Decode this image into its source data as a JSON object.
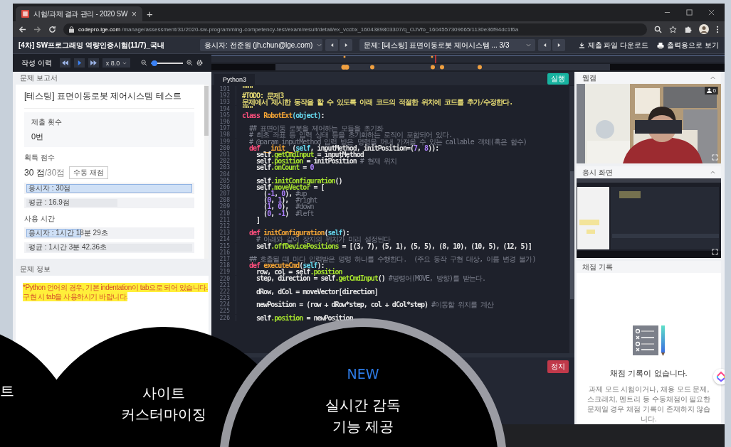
{
  "browser": {
    "tab_title": "시험/과제 결과 관리 - 2020 SW",
    "tab_close": "×",
    "new_tab": "+",
    "url_host": "codepro.lge.com",
    "url_path": "/manage/assessment/31/2020-sw-programming-competency-test/exam/result/detail/ex_vccbx_1604389803307/q_OJVfo_1604557309665/1130e36f94dc1f6a"
  },
  "app_header": {
    "title": "[4차] SW프로그래밍 역량인증시험(11/7)_국내",
    "candidate": "응시자: 전준원 (jh.chun@lge.com)",
    "problem": "문제: [테스팅] 표면이동로봇 제어시스템 ... 3/3",
    "actions": [
      {
        "kind": "download",
        "label": "제출 파일 다운로드"
      },
      {
        "kind": "print",
        "label": "출력용으로 보기"
      }
    ]
  },
  "history_bar": {
    "label": "작성 이력",
    "speed": "x 8.0",
    "zoom": {
      "level": 0.1
    }
  },
  "report": {
    "header": "문제 보고서",
    "title": "[테스팅] 표면이동로봇 제어시스템 테스트",
    "submissions": {
      "label": "제출 횟수",
      "value": "0번"
    },
    "score": {
      "label": "획득 점수",
      "value": "30 점",
      "max": "/30점",
      "button": "수동 채점",
      "bars": [
        {
          "kind": "candidate",
          "text": "응시자 : 30점",
          "level": 1
        },
        {
          "kind": "average",
          "text": "평균 : 16.9점",
          "level": 0.55
        }
      ]
    },
    "time": {
      "label": "사용 시간",
      "bars": [
        {
          "kind": "candidate",
          "text": "응시자 : 1시간 18분 29초",
          "level": 0.33
        },
        {
          "kind": "average",
          "text": "평균 : 1시간 3분 42.36초",
          "level": 1
        }
      ]
    }
  },
  "problem_info": {
    "header": "문제 정보",
    "notice": [
      "*Python 언어의 경우, 기본 indentation이 tab으로 되어 있습니다.",
      "구현 시 tab을 사용하시기 바랍니다."
    ]
  },
  "editor": {
    "tab": "Python3",
    "run_button": "실행",
    "stop_button": "정지",
    "lines": [
      {
        "number": "191",
        "tokens": [
          {
            "kind": "str",
            "text": "\"\"\""
          }
        ]
      },
      {
        "number": "192",
        "tokens": [
          {
            "kind": "str",
            "text": "#TODO: 문제3"
          }
        ]
      },
      {
        "number": "193",
        "tokens": [
          {
            "kind": "str",
            "text": "문제에서 제시한 동작을 할 수 있도록 아래 코드의 적절한 위치에 코드를 추가/수정한다."
          }
        ]
      },
      {
        "number": "194",
        "tokens": [
          {
            "kind": "str",
            "text": "\"\"\""
          }
        ]
      },
      {
        "number": "195",
        "tokens": [
          {
            "kind": "kw",
            "text": "class "
          },
          {
            "kind": "name",
            "text": "RobotExt"
          },
          {
            "kind": "type",
            "text": "(object)"
          },
          {
            "kind": "plain",
            "text": ":"
          }
        ]
      },
      {
        "number": "196"
      },
      {
        "number": "197",
        "tokens": [
          {
            "kind": "cmt",
            "text": "  ## 표면이동 로봇을 제어하는 모듈을 초기화"
          }
        ]
      },
      {
        "number": "198",
        "tokens": [
          {
            "kind": "cmt",
            "text": "  # 최초 좌표 등 입력 상태 등을 초기화하는 로직이 포함되어 있다."
          }
        ]
      },
      {
        "number": "199",
        "tokens": [
          {
            "kind": "cmt",
            "text": "  # @param inputMethod 입력 받은 명령을 꺼내 가져올 수 있는 callable 객체(혹은 함수)"
          }
        ]
      },
      {
        "number": "200",
        "tokens": [
          {
            "kind": "kw",
            "text": "  def "
          },
          {
            "kind": "name",
            "text": "__init__"
          },
          {
            "kind": "plain",
            "text": "("
          },
          {
            "kind": "type",
            "text": "self"
          },
          {
            "kind": "plain",
            "text": ", inputMethod, initPosition=("
          },
          {
            "kind": "num",
            "text": "7"
          },
          {
            "kind": "plain",
            "text": ", "
          },
          {
            "kind": "num",
            "text": "8"
          },
          {
            "kind": "plain",
            "text": ")):"
          }
        ]
      },
      {
        "number": "201",
        "tokens": [
          {
            "kind": "plain",
            "text": "    self"
          },
          {
            "kind": "attr",
            "text": ".getCmdInput"
          },
          {
            "kind": "plain",
            "text": " = inputMethod"
          }
        ]
      },
      {
        "number": "202",
        "tokens": [
          {
            "kind": "plain",
            "text": "    self"
          },
          {
            "kind": "attr",
            "text": ".position"
          },
          {
            "kind": "plain",
            "text": " = initPosition "
          },
          {
            "kind": "cmt",
            "text": "# 현재 위치"
          }
        ]
      },
      {
        "number": "203",
        "tokens": [
          {
            "kind": "plain",
            "text": "    self"
          },
          {
            "kind": "attr",
            "text": ".onCount"
          },
          {
            "kind": "plain",
            "text": " = "
          },
          {
            "kind": "num",
            "text": "0"
          }
        ]
      },
      {
        "number": "204"
      },
      {
        "number": "205",
        "tokens": [
          {
            "kind": "plain",
            "text": "    self"
          },
          {
            "kind": "attr",
            "text": ".initConfiguration"
          },
          {
            "kind": "plain",
            "text": "()"
          }
        ]
      },
      {
        "number": "206",
        "tokens": [
          {
            "kind": "plain",
            "text": "    self"
          },
          {
            "kind": "attr",
            "text": ".moveVector"
          },
          {
            "kind": "plain",
            "text": " = ["
          }
        ]
      },
      {
        "number": "207",
        "tokens": [
          {
            "kind": "plain",
            "text": "      ("
          },
          {
            "kind": "num",
            "text": "-1"
          },
          {
            "kind": "plain",
            "text": ", "
          },
          {
            "kind": "num",
            "text": "0"
          },
          {
            "kind": "plain",
            "text": "), "
          },
          {
            "kind": "cmt",
            "text": "#up"
          }
        ]
      },
      {
        "number": "208",
        "tokens": [
          {
            "kind": "plain",
            "text": "      ("
          },
          {
            "kind": "num",
            "text": "0"
          },
          {
            "kind": "plain",
            "text": ", "
          },
          {
            "kind": "num",
            "text": "1"
          },
          {
            "kind": "plain",
            "text": "),  "
          },
          {
            "kind": "cmt",
            "text": "#right"
          }
        ]
      },
      {
        "number": "209",
        "tokens": [
          {
            "kind": "plain",
            "text": "      ("
          },
          {
            "kind": "num",
            "text": "1"
          },
          {
            "kind": "plain",
            "text": ", "
          },
          {
            "kind": "num",
            "text": "0"
          },
          {
            "kind": "plain",
            "text": "),  "
          },
          {
            "kind": "cmt",
            "text": "#down"
          }
        ]
      },
      {
        "number": "210",
        "tokens": [
          {
            "kind": "plain",
            "text": "      ("
          },
          {
            "kind": "num",
            "text": "0"
          },
          {
            "kind": "plain",
            "text": ", "
          },
          {
            "kind": "num",
            "text": "-1"
          },
          {
            "kind": "plain",
            "text": ")  "
          },
          {
            "kind": "cmt",
            "text": "#left"
          }
        ]
      },
      {
        "number": "211",
        "tokens": [
          {
            "kind": "plain",
            "text": "    ]"
          }
        ]
      },
      {
        "number": "212"
      },
      {
        "number": "213",
        "tokens": [
          {
            "kind": "kw",
            "text": "  def "
          },
          {
            "kind": "name",
            "text": "initConfiguration"
          },
          {
            "kind": "plain",
            "text": "("
          },
          {
            "kind": "type",
            "text": "self"
          },
          {
            "kind": "plain",
            "text": "):"
          }
        ]
      },
      {
        "number": "214",
        "tokens": [
          {
            "kind": "cmt",
            "text": "    # 아래와 같이 장치의 위치가 미리 설정된다"
          }
        ]
      },
      {
        "number": "215",
        "tokens": [
          {
            "kind": "plain",
            "text": "    self"
          },
          {
            "kind": "attr",
            "text": ".offDevicePositions"
          },
          {
            "kind": "plain",
            "text": " = [(3, 7), (5, 1), (5, 5), (8, 10), (10, 5), (12, 5)]"
          }
        ]
      },
      {
        "number": "216"
      },
      {
        "number": "217",
        "tokens": [
          {
            "kind": "cmt",
            "text": "  ## 호출될 때 마다 입력받은 명령 하나를 수행한다.  (주요 동작 구현 대상, 이름 변경 불가)"
          }
        ]
      },
      {
        "number": "218",
        "tokens": [
          {
            "kind": "kw",
            "text": "  def "
          },
          {
            "kind": "name",
            "text": "executeCmd"
          },
          {
            "kind": "plain",
            "text": "("
          },
          {
            "kind": "type",
            "text": "self"
          },
          {
            "kind": "plain",
            "text": "):"
          }
        ]
      },
      {
        "number": "219",
        "tokens": [
          {
            "kind": "plain",
            "text": "    row, col = self"
          },
          {
            "kind": "attr",
            "text": ".position"
          }
        ]
      },
      {
        "number": "220",
        "tokens": [
          {
            "kind": "plain",
            "text": "    step, direction = self"
          },
          {
            "kind": "attr",
            "text": ".getCmdInput"
          },
          {
            "kind": "plain",
            "text": "() "
          },
          {
            "kind": "cmt",
            "text": "#명령어(MOVE, 방향)를 받는다."
          }
        ]
      },
      {
        "number": "221"
      },
      {
        "number": "222",
        "tokens": [
          {
            "kind": "plain",
            "text": "    dRow, dCol = moveVector[direction]"
          }
        ]
      },
      {
        "number": "223"
      },
      {
        "number": "224",
        "tokens": [
          {
            "kind": "plain",
            "text": "    newPosition = (row + dRow*step, col + dCol*step) "
          },
          {
            "kind": "cmt",
            "text": "#이동할 위치를 계산"
          }
        ]
      },
      {
        "number": "225"
      },
      {
        "number": "226",
        "tokens": [
          {
            "kind": "plain",
            "text": "    self"
          },
          {
            "kind": "attr",
            "text": ".position"
          },
          {
            "kind": "plain",
            "text": " = newPosition"
          }
        ]
      }
    ]
  },
  "side": {
    "webcam": {
      "header": "웹캠",
      "viewers": "0"
    },
    "screen": {
      "header": "응시 화면"
    },
    "grading": {
      "header": "채점 기록",
      "empty_title": "채점 기록이 없습니다.",
      "empty_text": "과제 모드 시험이거나, 채용 모드 문제, 스크래치, 멘트리 등 수동채점이 필요한 문제일 경우 채점 기록이 존재하지 않습니다."
    }
  },
  "promo": [
    {
      "lines": [
        "트"
      ]
    },
    {
      "lines": [
        "사이트",
        "커스터마이징"
      ]
    },
    {
      "badge": "NEW",
      "lines": [
        "실시간 감독",
        "기능 제공"
      ]
    }
  ]
}
